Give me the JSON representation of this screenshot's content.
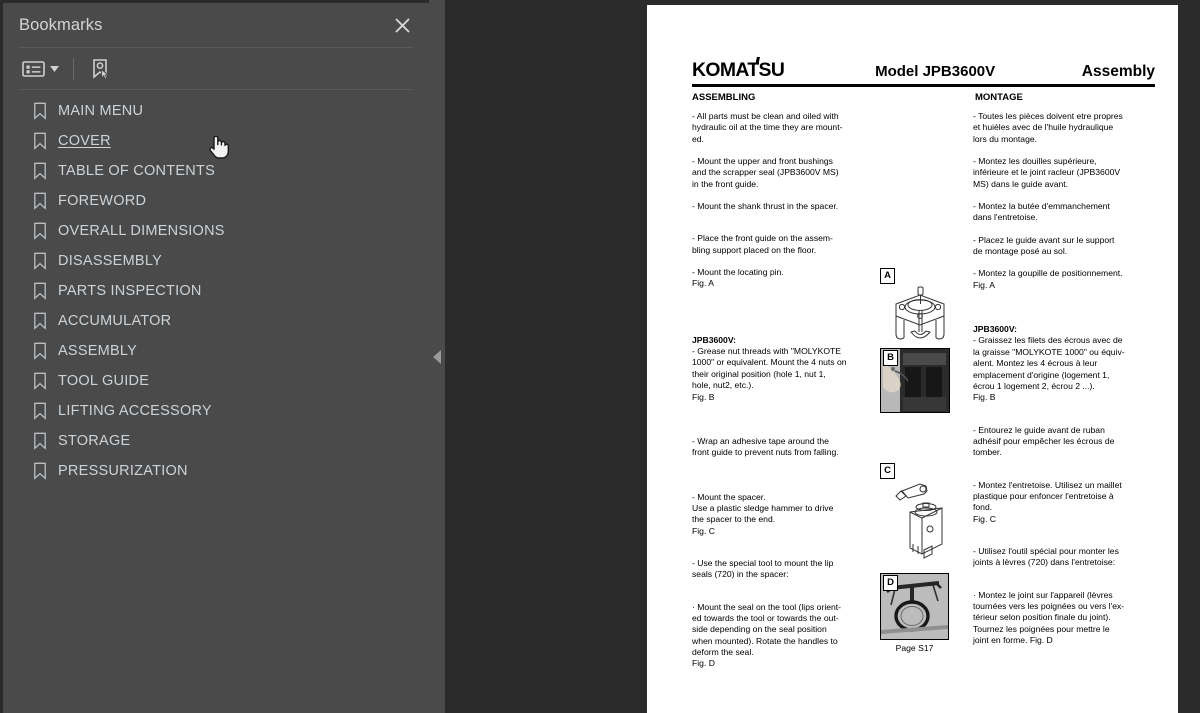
{
  "sidebar": {
    "title": "Bookmarks",
    "close_icon": "close-icon",
    "toolbar": {
      "options_icon": "list-options-icon",
      "caret_icon": "chevron-down-icon",
      "new_bookmark_icon": "new-bookmark-icon"
    },
    "items": [
      {
        "label": "MAIN MENU",
        "hovered": false
      },
      {
        "label": "COVER",
        "hovered": true
      },
      {
        "label": "TABLE OF CONTENTS",
        "hovered": false
      },
      {
        "label": "FOREWORD",
        "hovered": false
      },
      {
        "label": "OVERALL DIMENSIONS",
        "hovered": false
      },
      {
        "label": "DISASSEMBLY",
        "hovered": false
      },
      {
        "label": "PARTS INSPECTION",
        "hovered": false
      },
      {
        "label": "ACCUMULATOR",
        "hovered": false
      },
      {
        "label": "ASSEMBLY",
        "hovered": false
      },
      {
        "label": "TOOL GUIDE",
        "hovered": false
      },
      {
        "label": "LIFTING ACCESSORY",
        "hovered": false
      },
      {
        "label": "STORAGE",
        "hovered": false
      },
      {
        "label": "PRESSURIZATION",
        "hovered": false
      }
    ]
  },
  "splitter": {
    "collapse_icon": "collapse-left-arrow-icon"
  },
  "document": {
    "brand": "KOMATSU",
    "model": "Model JPB3600V",
    "section": "Assembly",
    "subhead_en": "ASSEMBLING",
    "subhead_fr": "MONTAGE",
    "english": {
      "p1": "- All parts must be clean and oiled with\nhydraulic oil at the time they are mount-\ned.",
      "p2": "- Mount the upper and front bushings\nand the scrapper seal (JPB3600V MS)\nin the front guide.",
      "p3": "- Mount the shank thrust in the spacer.",
      "p4": "- Place the front guide on the assem-\nbling support placed on the floor.",
      "p5": "- Mount the locating pin.\nFig. A",
      "h2": "JPB3600V:",
      "p6": "- Grease nut threads with \"MOLYKOTE\n1000\" or equivalent. Mount the 4 nuts on\ntheir original position (hole 1, nut 1,\nhole, nut2, etc.).\nFig. B",
      "p7": "- Wrap an adhesive tape around the\nfront guide to prevent nuts from falling.",
      "p8": "- Mount the spacer.\nUse a plastic sledge hammer to drive\nthe spacer to the end.\nFig. C",
      "p9": "- Use the special tool to mount the lip\nseals (720) in the spacer:",
      "p10": "· Mount the seal on the tool (lips orient-\ned towards the tool or towards the out-\nside depending on the seal position\nwhen mounted). Rotate the handles to\ndeform the seal.\nFig. D"
    },
    "french": {
      "p1": "- Toutes les pièces doivent etre propres\net huiéles avec de l'huile hydraulique\nlors du montage.",
      "p2": "- Montez les douilles supérieure,\ninférieure et le joint racleur (JPB3600V\nMS) dans le guide avant.",
      "p3": "- Montez la butée d'emmanchement\ndans l'entretoise.",
      "p4": "- Placez le guide avant sur le support\nde montage posé au sol.",
      "p5": "- Montez la goupille de positionnement.\nFig. A",
      "h2": "JPB3600V:",
      "p6": "- Graissez les filets des écrous avec de\nla graisse \"MOLYKOTE 1000\" ou équiv-\nalent. Montez les 4 écrous à leur\nemplacement d'origine (logement 1,\nécrou 1 logement 2, écrou 2 ...).\nFig. B",
      "p7": "- Entourez le guide avant de ruban\nadhésif pour empêcher les écrous de\ntomber.",
      "p8": "- Montez l'entretoise. Utilisez un maillet\nplastique pour enfoncer l'entretoise à\nfond.\nFig. C",
      "p9": "- Utilisez l'outil spécial pour monter les\njoints à lèvres (720) dans l'entretoise:",
      "p10": "· Montez le joint sur l'appareil (lèvres\ntournées vers les poignées ou vers l'ex-\ntérieur selon position finale du joint).\nTournez les poignées pour mettre le\njoint en forme. Fig. D"
    },
    "figures": [
      {
        "letter": "A",
        "name": "figure-a-front-guide-locating-pin",
        "kind": "line-art"
      },
      {
        "letter": "B",
        "name": "figure-b-nut-mounting-photo",
        "kind": "photo"
      },
      {
        "letter": "C",
        "name": "figure-c-spacer-hammer",
        "kind": "line-art"
      },
      {
        "letter": "D",
        "name": "figure-d-seal-tool-photo",
        "kind": "photo"
      }
    ],
    "page_label": "Page S17"
  }
}
